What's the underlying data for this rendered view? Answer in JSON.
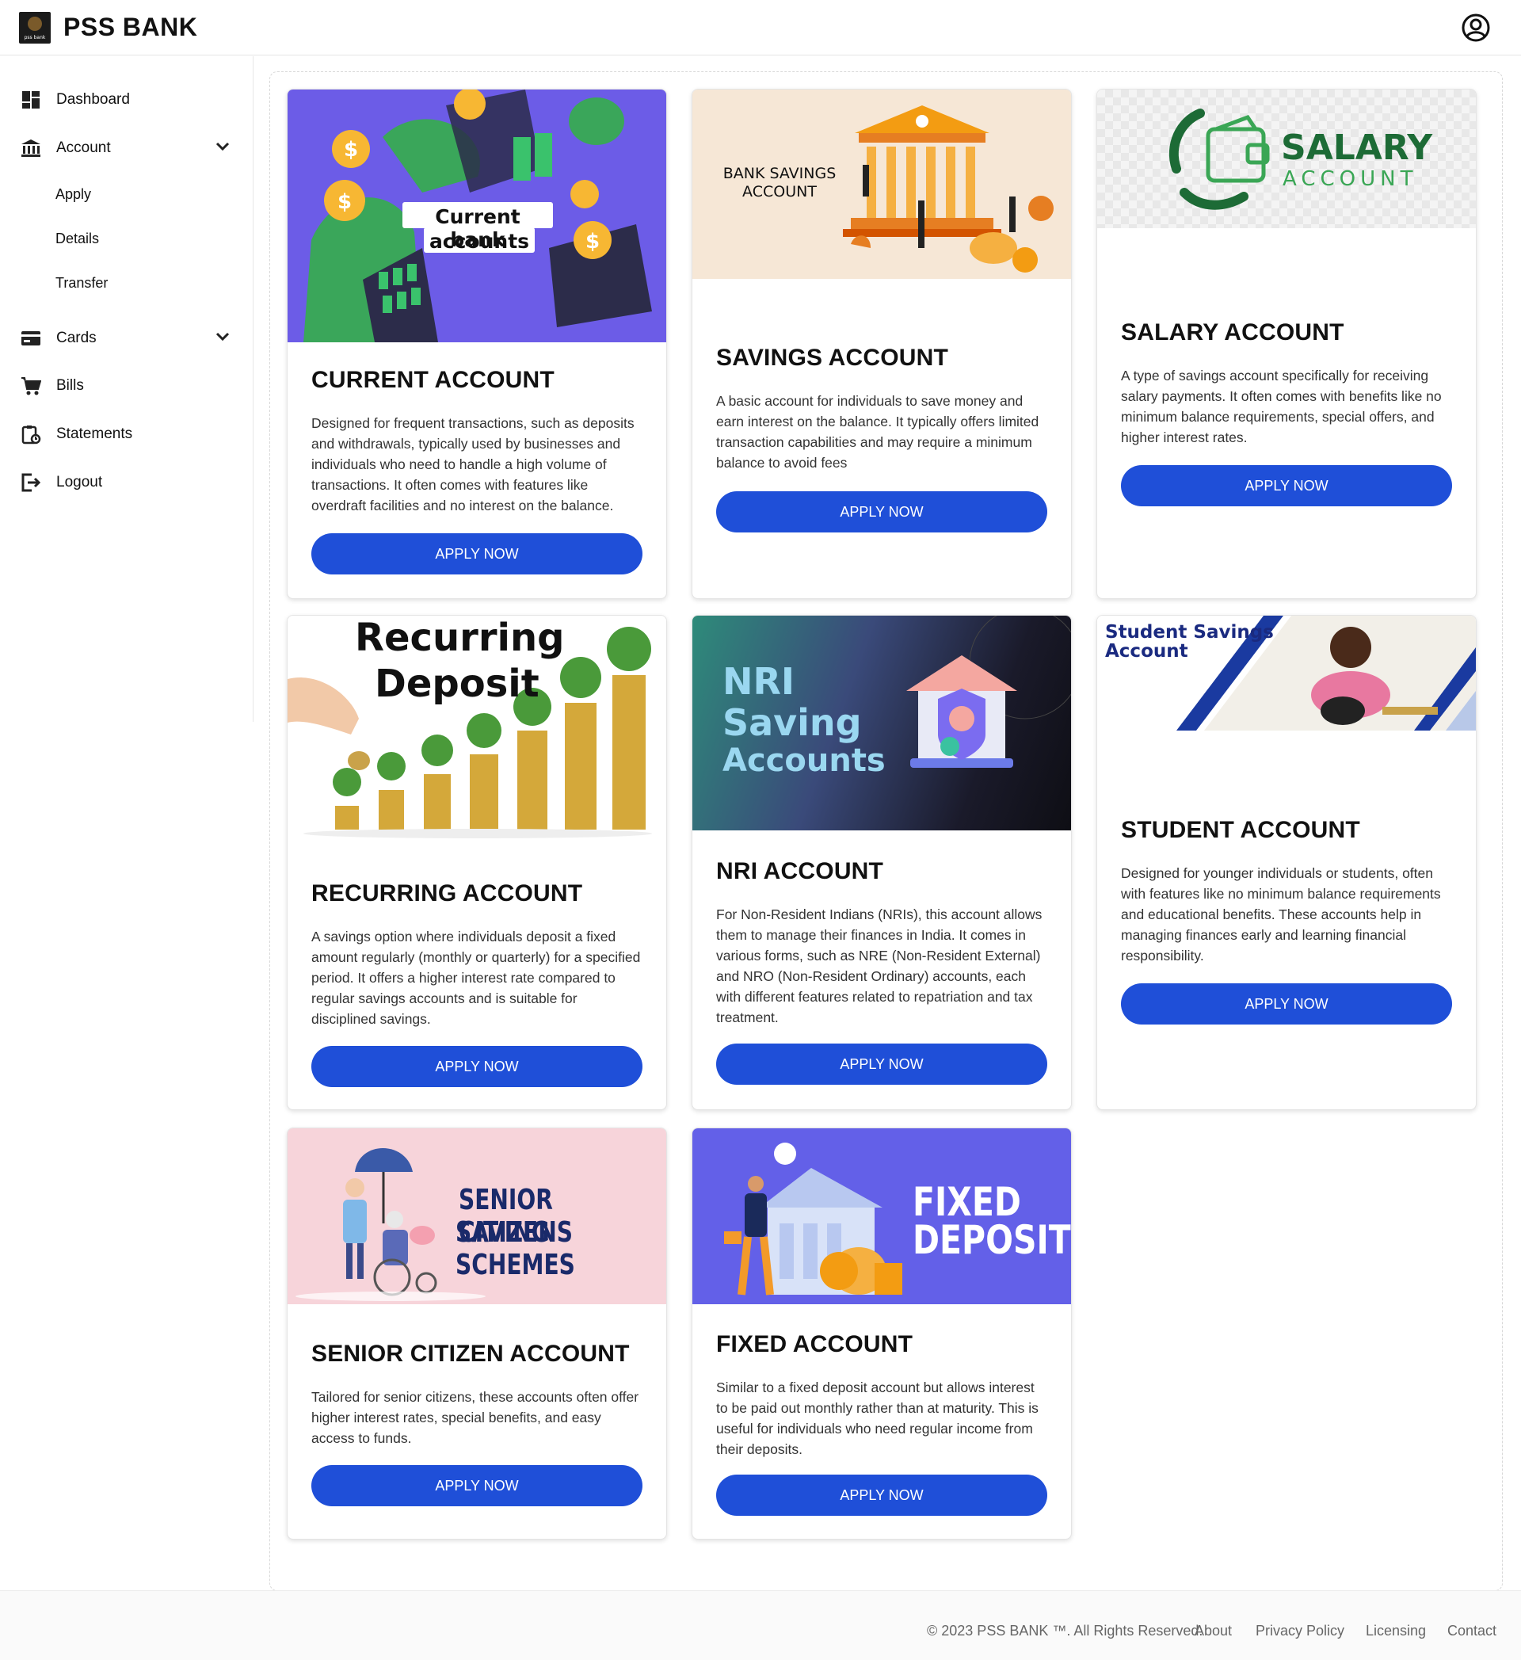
{
  "header": {
    "brand": "PSS BANK",
    "logo_text": "pss bank"
  },
  "sidebar": {
    "items": [
      {
        "label": "Dashboard",
        "icon": "dashboard-icon"
      },
      {
        "label": "Account",
        "icon": "bank-icon",
        "expanded": true,
        "children": [
          "Apply",
          "Details",
          "Transfer"
        ]
      },
      {
        "label": "Cards",
        "icon": "card-icon"
      },
      {
        "label": "Bills",
        "icon": "cart-icon"
      },
      {
        "label": "Statements",
        "icon": "statement-icon"
      },
      {
        "label": "Logout",
        "icon": "logout-icon"
      }
    ]
  },
  "cards": [
    {
      "title": "CURRENT ACCOUNT",
      "image_text": [
        "Current bank",
        "accounts"
      ],
      "description": "Designed for frequent transactions, such as deposits and withdrawals, typically used by businesses and individuals who need to handle a high volume of transactions. It often comes with features like overdraft facilities and no interest on the balance.",
      "button": "APPLY NOW"
    },
    {
      "title": "SAVINGS ACCOUNT",
      "image_text": [
        "BANK SAVINGS",
        "ACCOUNT"
      ],
      "description": "A basic account for individuals to save money and earn interest on the balance. It typically offers limited transaction capabilities and may require a minimum balance to avoid fees",
      "button": "APPLY NOW"
    },
    {
      "title": "SALARY ACCOUNT",
      "image_text": [
        "SALARY",
        "ACCOUNT"
      ],
      "description": "A type of savings account specifically for receiving salary payments. It often comes with benefits like no minimum balance requirements, special offers, and higher interest rates.",
      "button": "APPLY NOW"
    },
    {
      "title": "RECURRING ACCOUNT",
      "image_text": [
        "Recurring",
        "Deposit"
      ],
      "description": "A savings option where individuals deposit a fixed amount regularly (monthly or quarterly) for a specified period. It offers a higher interest rate compared to regular savings accounts and is suitable for disciplined savings.",
      "button": "APPLY NOW"
    },
    {
      "title": "NRI ACCOUNT",
      "image_text": [
        "NRI",
        "Saving",
        "Accounts"
      ],
      "description": "For Non-Resident Indians (NRIs), this account allows them to manage their finances in India. It comes in various forms, such as NRE (Non-Resident External) and NRO (Non-Resident Ordinary) accounts, each with different features related to repatriation and tax treatment.",
      "button": "APPLY NOW"
    },
    {
      "title": "STUDENT ACCOUNT",
      "image_text": [
        "Student Savings",
        "Account"
      ],
      "description": "Designed for younger individuals or students, often with features like no minimum balance requirements and educational benefits. These accounts help in managing finances early and learning financial responsibility.",
      "button": "APPLY NOW"
    },
    {
      "title": "SENIOR CITIZEN ACCOUNT",
      "image_text": [
        "SENIOR CITIZENS",
        "SAVING SCHEMES"
      ],
      "description": "Tailored for senior citizens, these accounts often offer higher interest rates, special benefits, and easy access to funds.",
      "button": "APPLY NOW"
    },
    {
      "title": "FIXED ACCOUNT",
      "image_text": [
        "FIXED",
        "DEPOSIT"
      ],
      "description": "Similar to a fixed deposit account but allows interest to be paid out monthly rather than at maturity. This is useful for individuals who need regular income from their deposits.",
      "button": "APPLY NOW"
    }
  ],
  "footer": {
    "copyright": "© 2023 PSS BANK ™. All Rights Reserved.",
    "links": [
      "About",
      "Privacy Policy",
      "Licensing",
      "Contact"
    ]
  },
  "colors": {
    "primary_button": "#1f4fd8",
    "text": "#111111"
  }
}
